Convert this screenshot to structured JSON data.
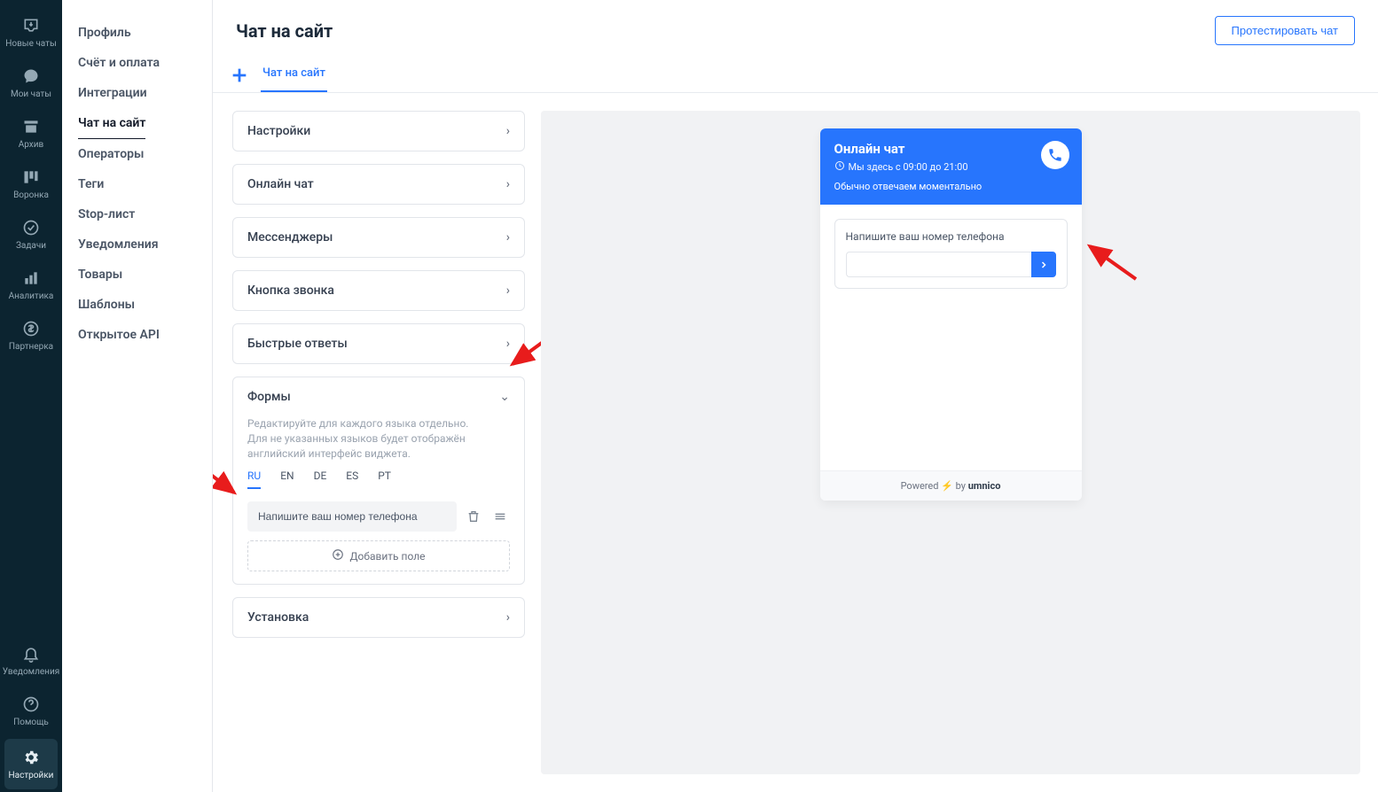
{
  "sidebar": [
    {
      "name": "new-chats",
      "label": "Новые чаты"
    },
    {
      "name": "my-chats",
      "label": "Мои чаты"
    },
    {
      "name": "archive",
      "label": "Архив"
    },
    {
      "name": "funnel",
      "label": "Воронка"
    },
    {
      "name": "tasks",
      "label": "Задачи"
    },
    {
      "name": "analytics",
      "label": "Аналитика"
    },
    {
      "name": "partner",
      "label": "Партнерка"
    }
  ],
  "sidebar_bottom": [
    {
      "name": "notifications",
      "label": "Уведомления"
    },
    {
      "name": "help",
      "label": "Помощь"
    },
    {
      "name": "settings",
      "label": "Настройки",
      "active": true
    }
  ],
  "settings_menu": [
    {
      "label": "Профиль"
    },
    {
      "label": "Счёт и оплата"
    },
    {
      "label": "Интеграции"
    },
    {
      "label": "Чат на сайт",
      "selected": true
    },
    {
      "label": "Операторы"
    },
    {
      "label": "Теги"
    },
    {
      "label": "Stop-лист"
    },
    {
      "label": "Уведомления"
    },
    {
      "label": "Товары"
    },
    {
      "label": "Шаблоны"
    },
    {
      "label": "Открытое API"
    }
  ],
  "page_title": "Чат на сайт",
  "test_button": "Протестировать чат",
  "tab_label": "Чат на сайт",
  "accordions": {
    "settings": "Настройки",
    "online_chat": "Онлайн чат",
    "messengers": "Мессенджеры",
    "call_button": "Кнопка звонка",
    "quick_replies": "Быстрые ответы",
    "forms": "Формы",
    "install": "Установка"
  },
  "forms": {
    "help": "Редактируйте для каждого языка отдельно.\nДля не указанных языков будет отображён английский интерфейс виджета.",
    "langs": [
      "RU",
      "EN",
      "DE",
      "ES",
      "PT"
    ],
    "field_value": "Напишите ваш номер телефона",
    "add_field": "Добавить поле"
  },
  "widget": {
    "title": "Онлайн чат",
    "hours": "Мы здесь с 09:00 до 21:00",
    "reply": "Обычно отвечаем моментально",
    "form_label": "Напишите ваш номер телефона",
    "footer_prefix": "Powered",
    "footer_by": "by",
    "footer_brand": "umnico"
  }
}
